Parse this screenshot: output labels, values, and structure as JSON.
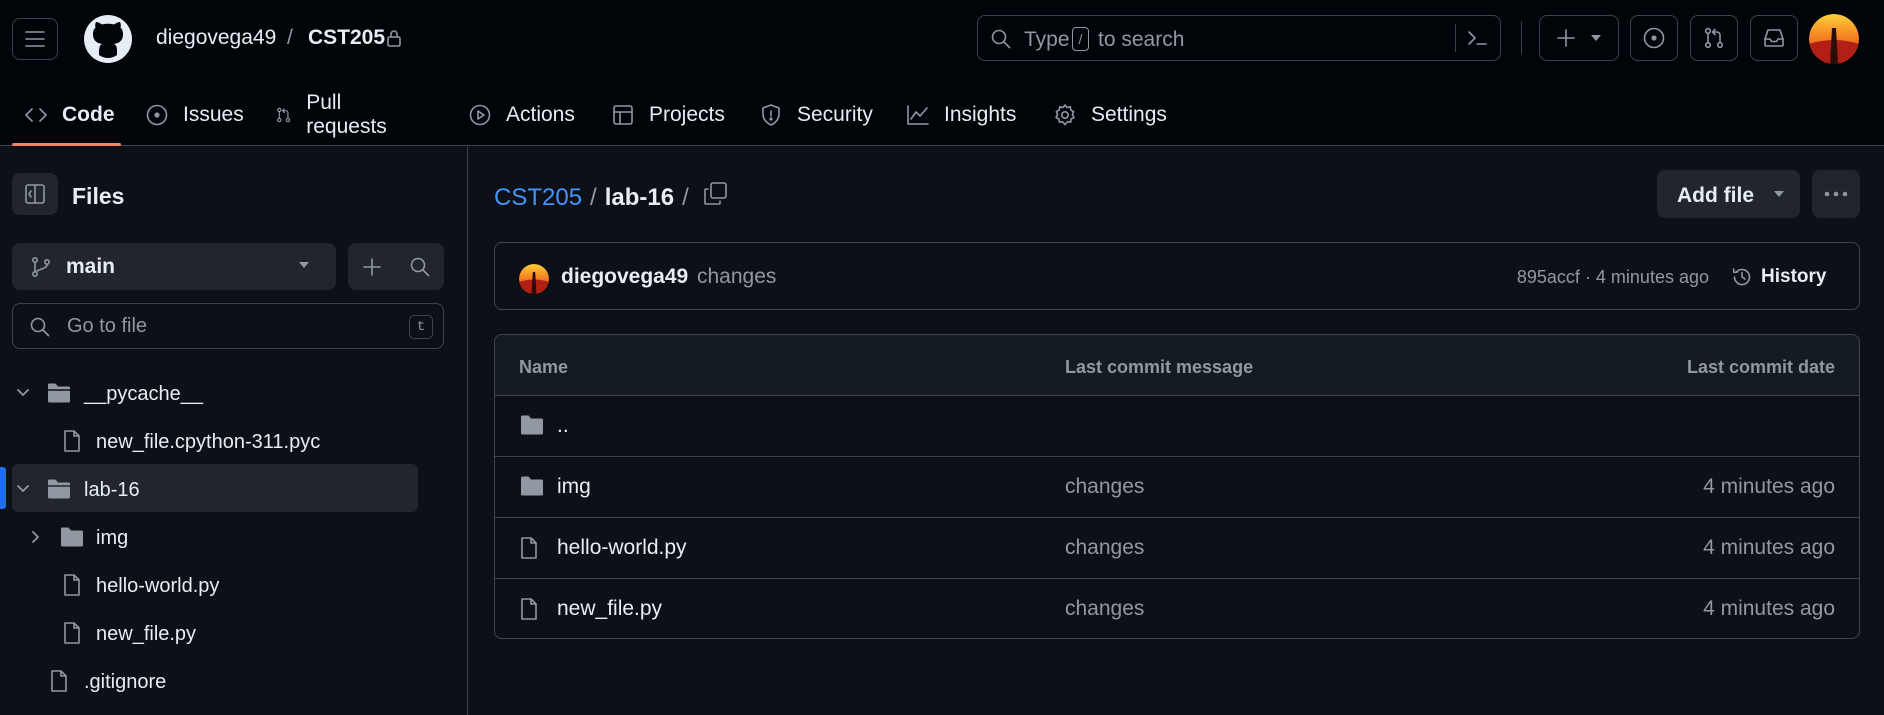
{
  "header": {
    "owner": "diegovega49",
    "separator": "/",
    "repo": "CST205",
    "search": {
      "prefix": "Type",
      "key": "/",
      "suffix": "to search"
    }
  },
  "nav": {
    "tabs": [
      {
        "label": "Code",
        "icon": "code-icon",
        "selected": true
      },
      {
        "label": "Issues",
        "icon": "issue-opened-icon"
      },
      {
        "label": "Pull requests",
        "icon": "git-pull-request-icon"
      },
      {
        "label": "Actions",
        "icon": "play-icon"
      },
      {
        "label": "Projects",
        "icon": "table-icon"
      },
      {
        "label": "Security",
        "icon": "shield-icon"
      },
      {
        "label": "Insights",
        "icon": "graph-icon"
      },
      {
        "label": "Settings",
        "icon": "gear-icon"
      }
    ]
  },
  "sidebar": {
    "title": "Files",
    "branch": "main",
    "goto_placeholder": "Go to file",
    "goto_key": "t",
    "tree": [
      {
        "label": "__pycache__",
        "type": "folder",
        "expanded": true
      },
      {
        "label": "new_file.cpython-311.pyc",
        "type": "file"
      },
      {
        "label": "lab-16",
        "type": "folder",
        "expanded": true,
        "selected": true
      },
      {
        "label": "img",
        "type": "folder",
        "expanded": false
      },
      {
        "label": "hello-world.py",
        "type": "file"
      },
      {
        "label": "new_file.py",
        "type": "file"
      },
      {
        "label": ".gitignore",
        "type": "file"
      }
    ]
  },
  "main": {
    "breadcrumb": {
      "repo": "CST205",
      "dir": "lab-16",
      "separator": "/"
    },
    "add_file_label": "Add file",
    "commit": {
      "author": "diegovega49",
      "message": "changes",
      "meta": "895accf · 4 minutes ago",
      "history_label": "History"
    },
    "table": {
      "headers": {
        "name": "Name",
        "message": "Last commit message",
        "date": "Last commit date"
      },
      "rows": [
        {
          "name": "..",
          "type": "folder",
          "message": "",
          "date": ""
        },
        {
          "name": "img",
          "type": "folder",
          "message": "changes",
          "date": "4 minutes ago"
        },
        {
          "name": "hello-world.py",
          "type": "file",
          "message": "changes",
          "date": "4 minutes ago"
        },
        {
          "name": "new_file.py",
          "type": "file",
          "message": "changes",
          "date": "4 minutes ago"
        }
      ]
    }
  },
  "colors": {
    "background": "#0d1117",
    "header_bg": "#010409",
    "accent_link": "#4493f8",
    "selected_tab_underline": "#f78166",
    "selected_tree_bar": "#1f6feb",
    "border": "#3d444d",
    "muted_text": "#9198a1"
  }
}
